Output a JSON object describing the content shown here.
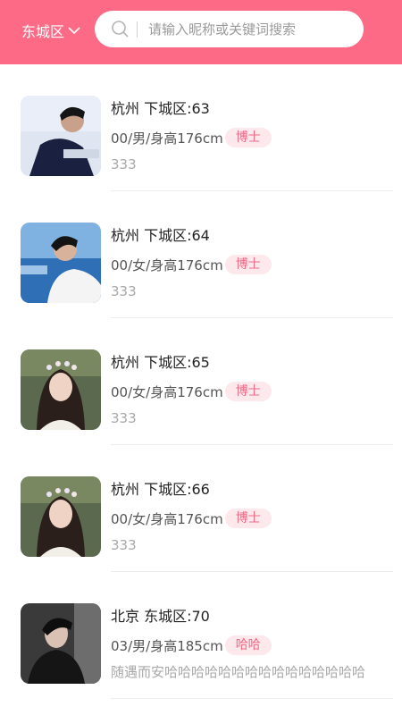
{
  "header": {
    "city": "东城区",
    "search_placeholder": "请输入昵称或关键词搜索"
  },
  "colors": {
    "header_bg": "#fd6a86",
    "badge_bg": "#fde8ec",
    "badge_text": "#f06a85"
  },
  "users": [
    {
      "location": "杭州 下城区:63",
      "detail": "00/男/身高176cm",
      "degree": "博士",
      "bio": "333"
    },
    {
      "location": "杭州 下城区:64",
      "detail": "00/女/身高176cm",
      "degree": "博士",
      "bio": "333"
    },
    {
      "location": "杭州 下城区:65",
      "detail": "00/女/身高176cm",
      "degree": "博士",
      "bio": "333"
    },
    {
      "location": "杭州 下城区:66",
      "detail": "00/女/身高176cm",
      "degree": "博士",
      "bio": "333"
    },
    {
      "location": "北京 东城区:70",
      "detail": "03/男/身高185cm",
      "degree": "哈哈",
      "bio": "随遇而安哈哈哈哈哈哈哈哈哈哈哈哈哈哈哈"
    }
  ]
}
